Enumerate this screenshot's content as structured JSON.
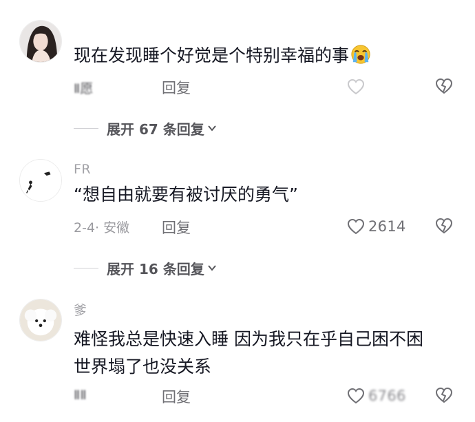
{
  "comments": [
    {
      "username": "",
      "text": "现在发现睡个好觉是个特别幸福的事",
      "emoji_icon": "loudly-crying-face-icon",
      "meta": "",
      "meta_blurred": "Ⅱ愿",
      "reply_label": "回复",
      "like_count": "",
      "like_count_blurred": false
    },
    {
      "username": "FR",
      "text": "“想自由就要有被讨厌的勇气”",
      "meta": "2-4· 安徽",
      "meta_blurred": "",
      "reply_label": "回复",
      "like_count": "2614",
      "like_count_blurred": false
    },
    {
      "username": "爹",
      "text_line1": "难怪我总是快速入睡 因为我只在乎自己困不困",
      "text_line2": "世界塌了也没关系",
      "meta": "",
      "meta_blurred": "ⅡⅡ",
      "reply_label": "回复",
      "like_count": "6766",
      "like_count_blurred": true
    }
  ],
  "expanders": [
    {
      "label": "展开 67 条回复"
    },
    {
      "label": "展开 16 条回复"
    }
  ],
  "colors": {
    "text_primary": "#161823",
    "text_secondary": "#9b9ba0",
    "background": "#ffffff",
    "emoji_yellow": "#f7c531",
    "emoji_tears": "#5cb3f1"
  }
}
